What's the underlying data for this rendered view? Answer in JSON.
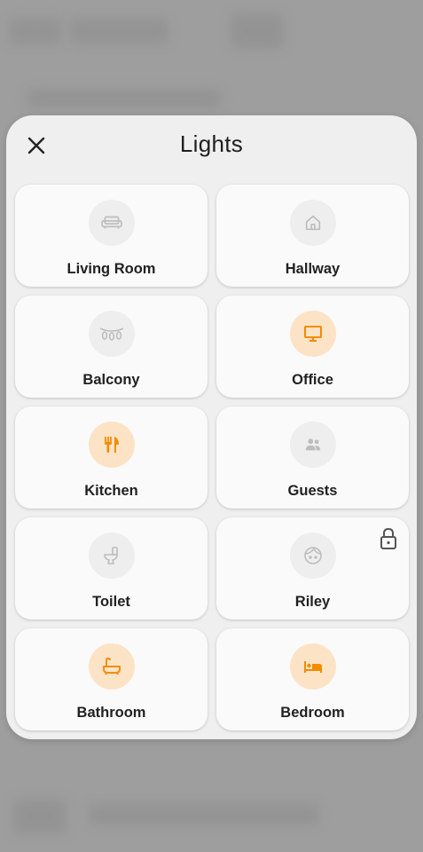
{
  "dialog": {
    "title": "Lights"
  },
  "colors": {
    "on_icon": "#f28c00",
    "off_icon": "#bdbdbd",
    "on_bg": "#fce3c6",
    "off_bg": "#eeeeee"
  },
  "tiles": [
    {
      "label": "Living Room",
      "icon": "sofa-icon",
      "state": "off"
    },
    {
      "label": "Hallway",
      "icon": "home-icon",
      "state": "off"
    },
    {
      "label": "Balcony",
      "icon": "string-lights-icon",
      "state": "off"
    },
    {
      "label": "Office",
      "icon": "monitor-icon",
      "state": "on"
    },
    {
      "label": "Kitchen",
      "icon": "fork-knife-icon",
      "state": "on"
    },
    {
      "label": "Guests",
      "icon": "people-icon",
      "state": "off"
    },
    {
      "label": "Toilet",
      "icon": "toilet-icon",
      "state": "off"
    },
    {
      "label": "Riley",
      "icon": "face-icon",
      "state": "off",
      "locked": true
    },
    {
      "label": "Bathroom",
      "icon": "bathtub-icon",
      "state": "on"
    },
    {
      "label": "Bedroom",
      "icon": "bed-icon",
      "state": "on"
    }
  ]
}
